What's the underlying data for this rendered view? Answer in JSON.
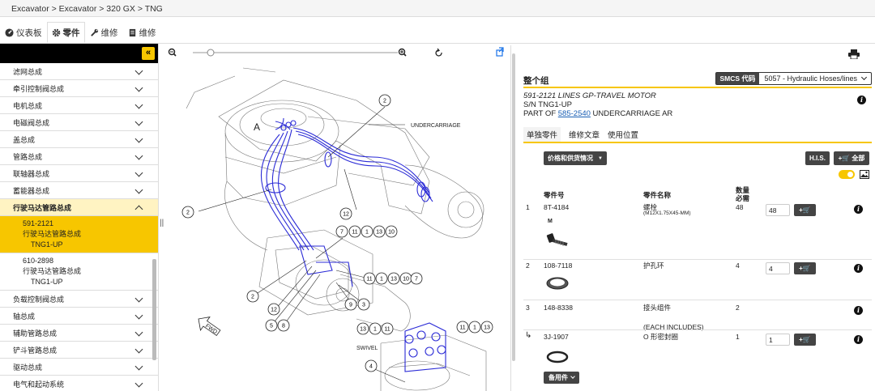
{
  "breadcrumb": "Excavator > Excavator > 320 GX > TNG",
  "tabs": [
    {
      "label": "仪表板"
    },
    {
      "label": "零件"
    },
    {
      "label": "维修"
    },
    {
      "label": "维修"
    }
  ],
  "sidebar": {
    "collapse_label": "«",
    "items_top": [
      "滤网总成",
      "牵引控制阀总成",
      "电机总成",
      "电磁阀总成",
      "盖总成",
      "管路总成",
      "联轴器总成",
      "蓄能器总成"
    ],
    "expanded": {
      "label": "行驶马达管路总成",
      "children": [
        {
          "part": "591-2121",
          "name": "行驶马达管路总成",
          "sn": "TNG1-UP"
        },
        {
          "part": "610-2898",
          "name": "行驶马达管路总成",
          "sn": "TNG1-UP"
        }
      ]
    },
    "items_bottom": [
      "负载控制阀总成",
      "轴总成",
      "辅助管路总成",
      "铲斗管路总成",
      "驱动总成",
      "电气和起动系统"
    ]
  },
  "diagram": {
    "labels": [
      "UNDERCARRIAGE",
      "SWIVEL",
      "FWD",
      "A"
    ],
    "callouts": [
      "2",
      "2",
      "12",
      "7",
      "11",
      "1",
      "13",
      "10",
      "2",
      "12",
      "5",
      "8",
      "11",
      "1",
      "13",
      "10",
      "7",
      "9",
      "3",
      "13",
      "1",
      "11",
      "11",
      "1",
      "13",
      "4"
    ]
  },
  "panel": {
    "title": "整个组",
    "smcs_label": "SMCS 代码",
    "smcs_value": "5057 - Hydraulic Hoses/lines",
    "group_line1": "591-2121 LINES GP-TRAVEL MOTOR",
    "group_line2": "S/N TNG1-UP",
    "part_of_prefix": "PART OF ",
    "part_of_link": "585-2540",
    "part_of_suffix": " UNDERCARRIAGE AR",
    "subtabs": [
      "单独零件",
      "维修文章",
      "使用位置"
    ],
    "price_btn": "价格和供货情况",
    "his_btn": "H.I.S.",
    "addall_btn": "+🛒 全部",
    "headers": {
      "part_no": "零件号",
      "part_name": "零件名称",
      "qty": "数量\n必需"
    },
    "rows": [
      {
        "idx": "1",
        "part": "8T-4184",
        "name": "螺栓",
        "note": "(M12X1.75X45-MM)",
        "qty": "48",
        "input": "48",
        "mark": "M"
      },
      {
        "idx": "2",
        "part": "108-7118",
        "name": "护孔环",
        "note": "",
        "qty": "4",
        "input": "4",
        "mark": ""
      },
      {
        "idx": "3",
        "part": "148-8338",
        "name": "接头组件",
        "note": "",
        "qty": "2",
        "input": "",
        "mark": ""
      },
      {
        "idx": "↳",
        "part": "3J-1907",
        "name": "O 形密封圈",
        "note": "",
        "qty": "1",
        "input": "1",
        "mark": ""
      }
    ],
    "each_includes": "(EACH INCLUDES)",
    "spare_btn": "备用件"
  },
  "colors": {
    "accent": "#f7c600",
    "dark_button": "#444444",
    "diagram_line": "#2b2bd6"
  }
}
